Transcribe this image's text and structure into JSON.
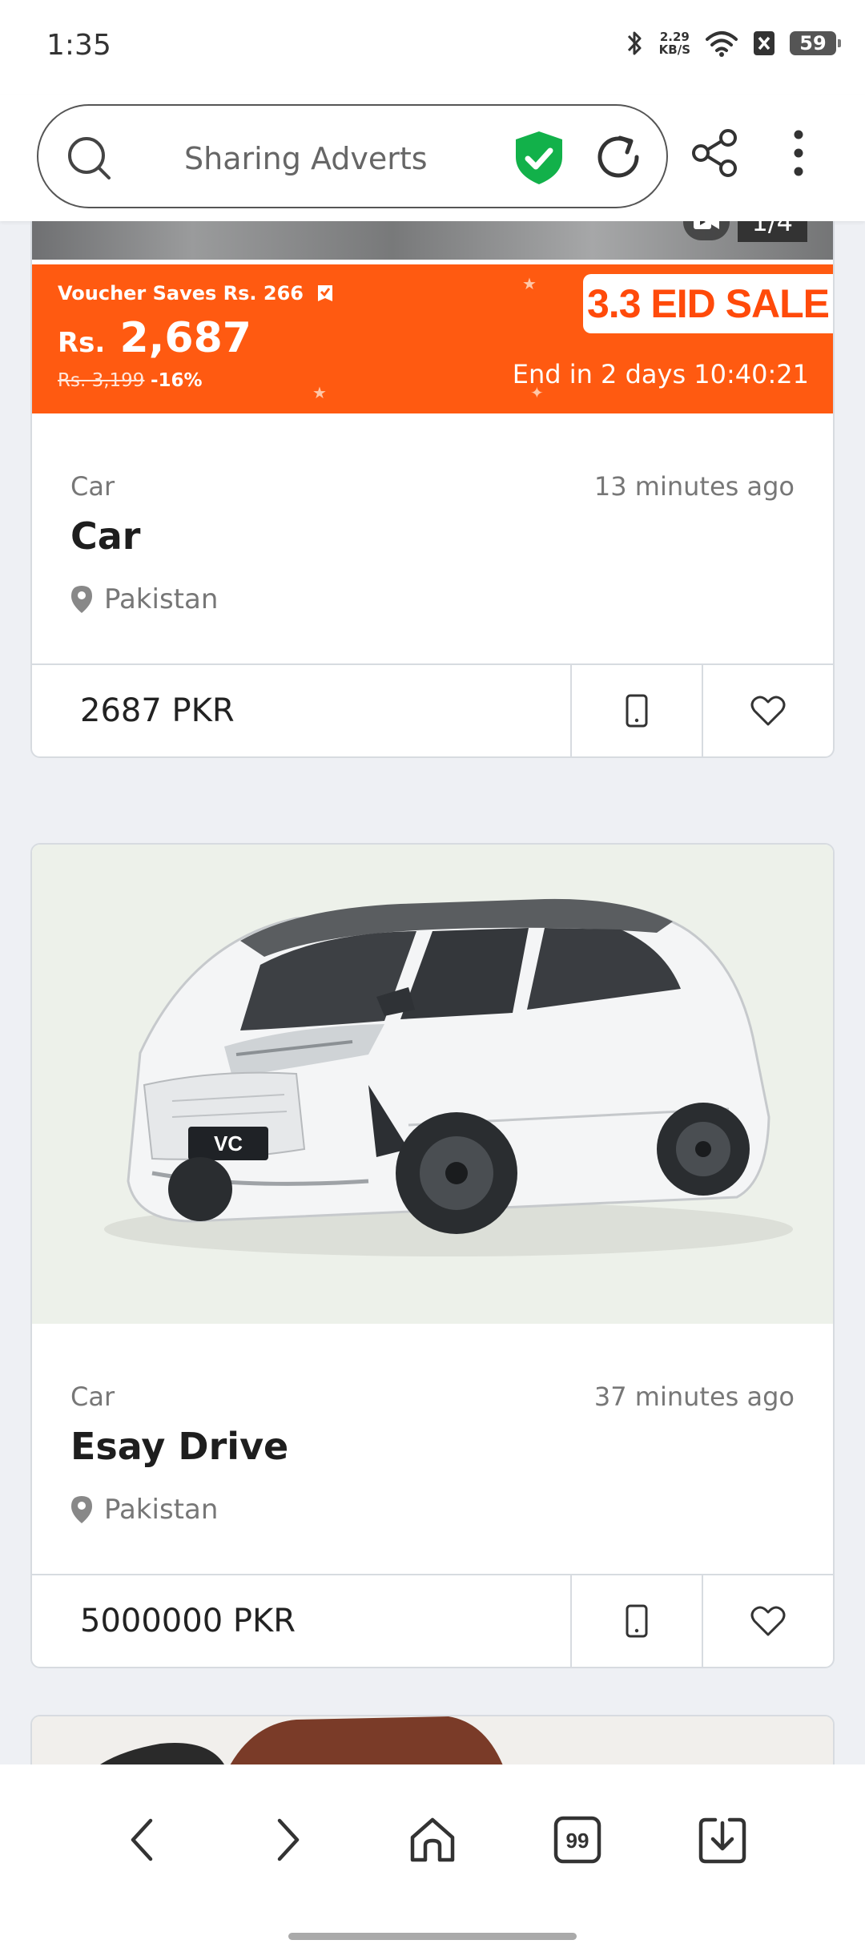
{
  "status_bar": {
    "time": "1:35",
    "net_speed_value": "2.29",
    "net_speed_unit": "KB/S",
    "battery": "59"
  },
  "browser": {
    "page_title": "Sharing Adverts"
  },
  "promo_banner": {
    "voucher_text": "Voucher Saves Rs. 266",
    "currency": "Rs.",
    "price": "2,687",
    "old_price": "Rs. 3,199",
    "discount": "-16%",
    "sale_label": "3.3 EID SALE",
    "countdown": "End in 2 days 10:40:21",
    "image_counter": "1/4"
  },
  "listings": [
    {
      "category": "Car",
      "posted": "13 minutes ago",
      "title": "Car",
      "location": "Pakistan",
      "price": "2687 PKR"
    },
    {
      "category": "Car",
      "posted": "37 minutes ago",
      "title": "Esay Drive",
      "location": "Pakistan",
      "price": "5000000 PKR",
      "plate_text": "VC"
    }
  ],
  "bottom_nav": {
    "tabs_count": "99"
  },
  "colors": {
    "promo_orange": "#ff5a11",
    "shield_green": "#12b14a",
    "card_border": "#d7dbe0",
    "page_bg": "#eef0f4"
  }
}
